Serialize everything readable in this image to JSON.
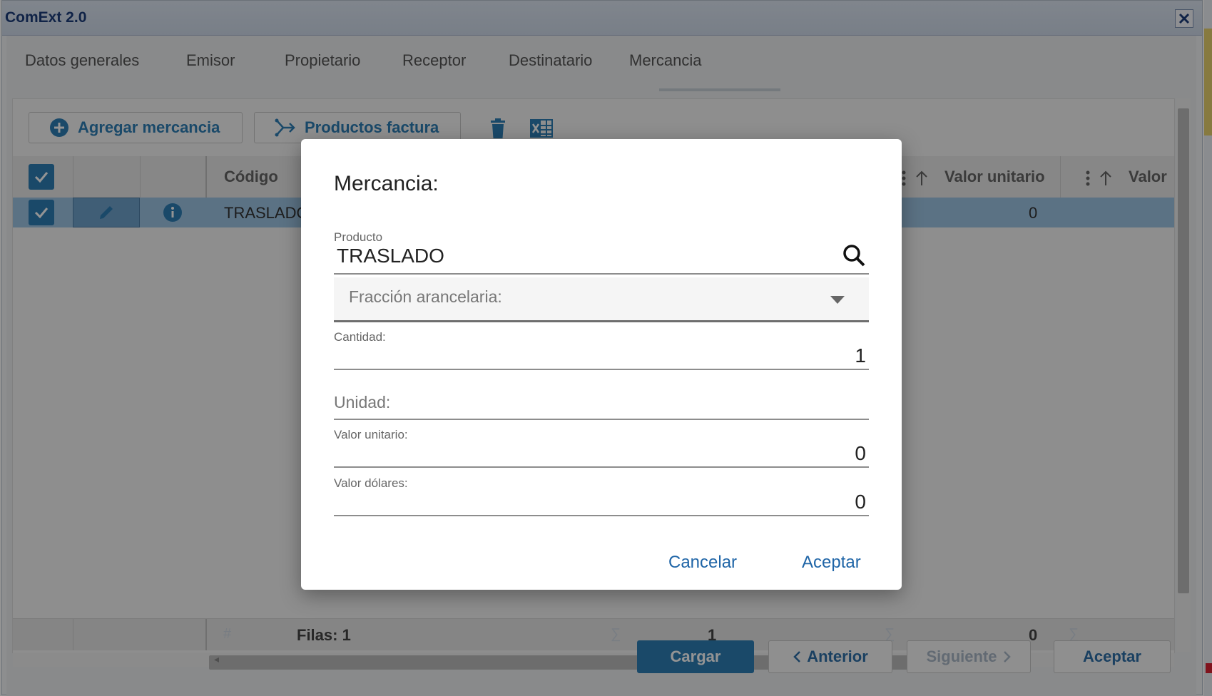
{
  "window": {
    "title": "ComExt 2.0"
  },
  "tabs": [
    {
      "label": "Datos generales"
    },
    {
      "label": "Emisor"
    },
    {
      "label": "Propietario"
    },
    {
      "label": "Receptor"
    },
    {
      "label": "Destinatario"
    },
    {
      "label": "Mercancia",
      "active": true
    }
  ],
  "toolbar": {
    "add_label": "Agregar mercancia",
    "products_label": "Productos factura"
  },
  "grid": {
    "columns": {
      "codigo": "Código",
      "valor_unitario": "Valor unitario",
      "valor": "Valor"
    },
    "row": {
      "codigo": "TRASLADO",
      "valor_unitario": "0"
    },
    "footer": {
      "filas": "Filas: 1",
      "cantidad_total": "1",
      "valor_total": "0"
    }
  },
  "bottom": {
    "cargar": "Cargar",
    "anterior": "Anterior",
    "siguiente": "Siguiente",
    "aceptar": "Aceptar"
  },
  "dialog": {
    "title": "Mercancia:",
    "producto_label": "Producto",
    "producto_value": "TRASLADO",
    "fraccion_label": "Fracción arancelaria:",
    "cantidad_label": "Cantidad:",
    "cantidad_value": "1",
    "unidad_label": "Unidad:",
    "valor_unitario_label": "Valor unitario:",
    "valor_unitario_value": "0",
    "valor_dolares_label": "Valor dólares:",
    "valor_dolares_value": "0",
    "cancel_label": "Cancelar",
    "accept_label": "Aceptar"
  },
  "colors": {
    "accent": "#2e7eb5",
    "selected_row": "#9ec5e4",
    "link": "#1f65a7"
  }
}
